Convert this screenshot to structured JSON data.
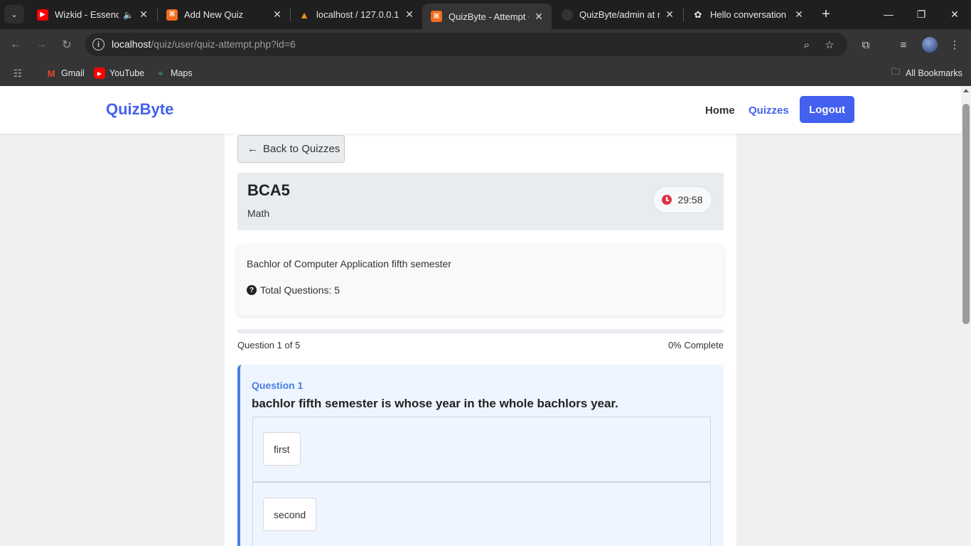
{
  "browser": {
    "tabs": [
      {
        "title": "Wizkid - Essence (",
        "favicon": "youtube-icon",
        "color": "#ff0000"
      },
      {
        "title": "Add New Quiz",
        "favicon": "xampp-icon",
        "color": "#f36b1c"
      },
      {
        "title": "localhost / 127.0.0.1 /",
        "favicon": "phpmyadmin-icon",
        "color": "#f29111"
      },
      {
        "title": "QuizByte - Attempt Q",
        "favicon": "xampp-icon",
        "color": "#f36b1c"
      },
      {
        "title": "QuizByte/admin at m",
        "favicon": "github-icon",
        "color": "#222222"
      },
      {
        "title": "Hello conversation",
        "favicon": "chatgpt-icon",
        "color": "#222222"
      }
    ],
    "url_host": "localhost",
    "url_path": "/quiz/user/quiz-attempt.php?id=6",
    "bookmarks": [
      {
        "label": "Gmail",
        "icon": "gmail-icon"
      },
      {
        "label": "YouTube",
        "icon": "youtube-icon"
      },
      {
        "label": "Maps",
        "icon": "maps-icon"
      }
    ],
    "all_bookmarks": "All Bookmarks"
  },
  "navbar": {
    "brand": "QuizByte",
    "links": [
      "Home",
      "Quizzes"
    ],
    "logout": "Logout",
    "accent": "#4361ee"
  },
  "quiz": {
    "back_label": "Back to Quizzes",
    "title": "BCA5",
    "subject": "Math",
    "timer": "29:58",
    "description": "Bachlor of Computer Application fifth semester",
    "total_questions": "Total Questions: 5",
    "progress_text": "Question 1 of 5",
    "progress_percent_text": "0% Complete",
    "progress_fraction": 0
  },
  "question": {
    "number_label": "Question 1",
    "text": "bachlor fifth semester is whose year in the whole bachlors year.",
    "options": [
      "first",
      "second"
    ]
  }
}
